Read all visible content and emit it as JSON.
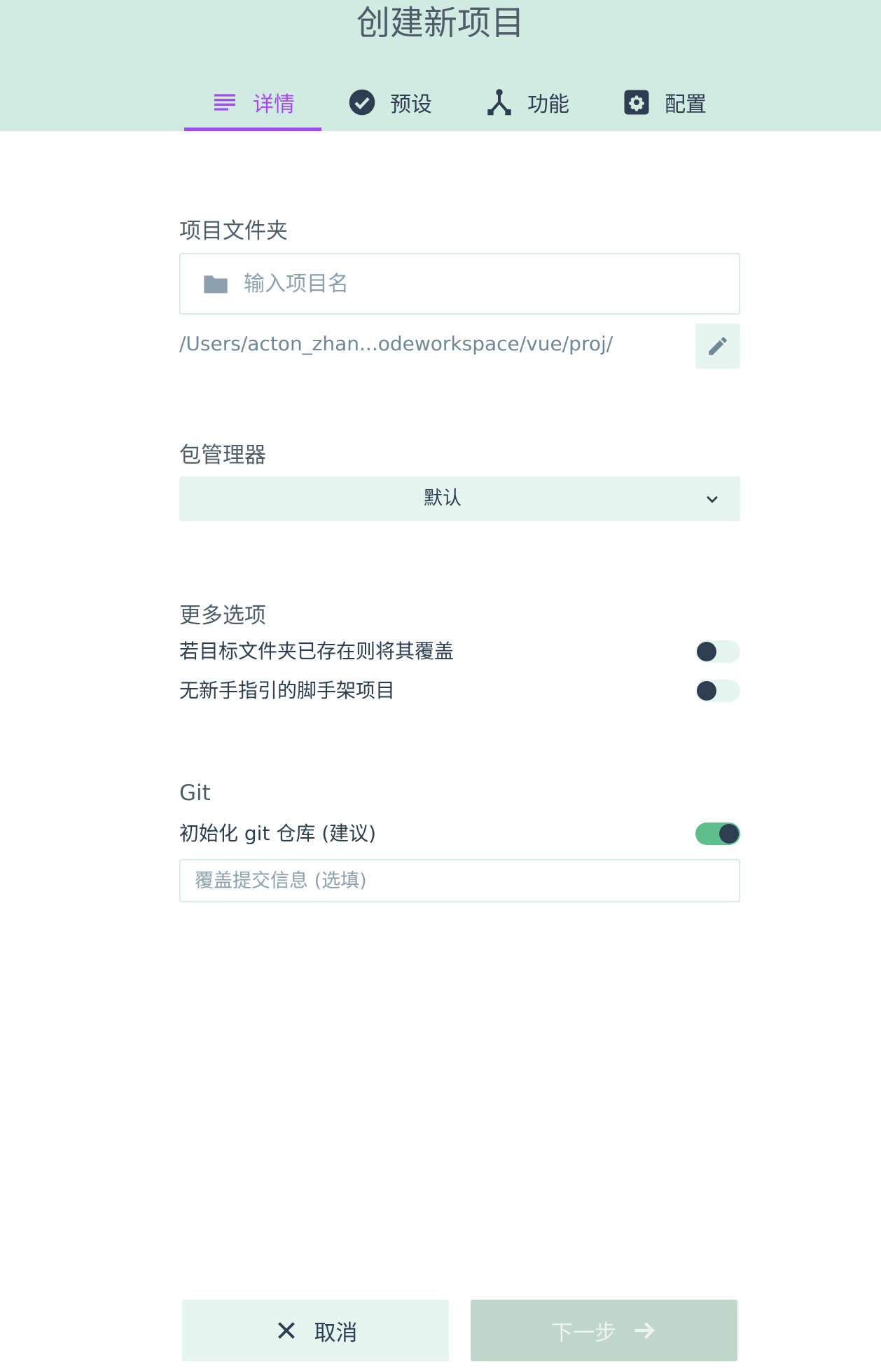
{
  "header": {
    "title": "创建新项目",
    "tabs": [
      {
        "label": "详情",
        "icon": "list-icon",
        "active": true
      },
      {
        "label": "预设",
        "icon": "check-circle-icon",
        "active": false
      },
      {
        "label": "功能",
        "icon": "merge-icon",
        "active": false
      },
      {
        "label": "配置",
        "icon": "gear-icon",
        "active": false
      }
    ]
  },
  "details": {
    "folder_label": "项目文件夹",
    "folder_placeholder": "输入项目名",
    "folder_value": "",
    "path": "/Users/acton_zhan...odeworkspace/vue/proj/",
    "package_manager_label": "包管理器",
    "package_manager_value": "默认",
    "more_options_label": "更多选项",
    "options": [
      {
        "label": "若目标文件夹已存在则将其覆盖",
        "enabled": false
      },
      {
        "label": "无新手指引的脚手架项目",
        "enabled": false
      }
    ],
    "git_label": "Git",
    "git_init_label": "初始化 git 仓库 (建议)",
    "git_init_enabled": true,
    "commit_placeholder": "覆盖提交信息 (选填)",
    "commit_value": ""
  },
  "footer": {
    "cancel_label": "取消",
    "next_label": "下一步"
  },
  "colors": {
    "header_bg": "#d1ebe2",
    "accent": "#a44cf0",
    "text": "#2c3e50",
    "toggle_on": "#5fbe8e",
    "light_green": "#e7f5f0",
    "disabled_button": "#bfd6cc"
  }
}
